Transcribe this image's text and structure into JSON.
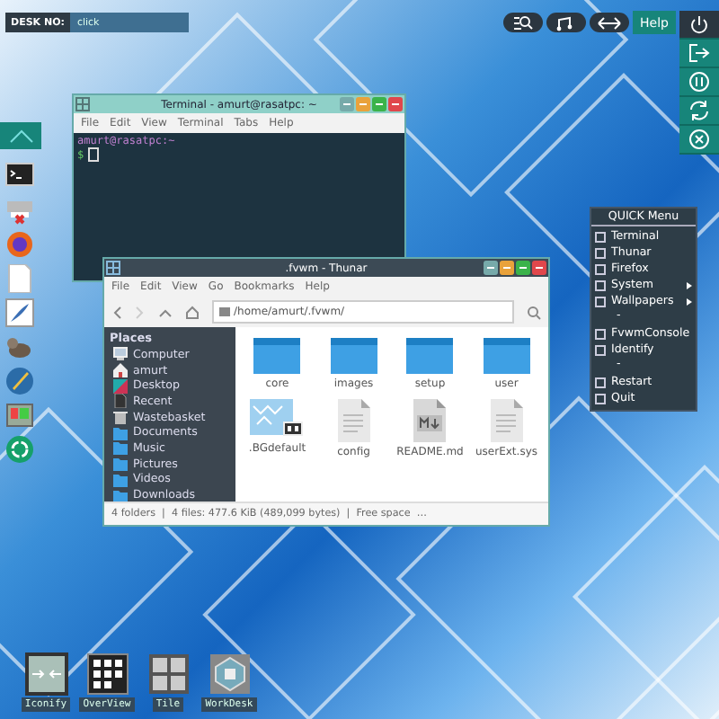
{
  "desk_switcher": {
    "label": "DESK NO:",
    "value": "click"
  },
  "top_panel": {
    "help_label": "Help"
  },
  "terminal": {
    "title": "Terminal - amurt@rasatpc: ~",
    "menu": [
      "File",
      "Edit",
      "View",
      "Terminal",
      "Tabs",
      "Help"
    ],
    "prompt": "amurt@rasatpc:~",
    "command_prompt": "$"
  },
  "file_manager": {
    "title": ".fvwm - Thunar",
    "menu": [
      "File",
      "Edit",
      "View",
      "Go",
      "Bookmarks",
      "Help"
    ],
    "path": "/home/amurt/.fvwm/",
    "places_header": "Places",
    "places": [
      {
        "label": "Computer",
        "kind": "computer",
        "selected": false
      },
      {
        "label": "amurt",
        "kind": "home",
        "selected": false
      },
      {
        "label": "Desktop",
        "kind": "desktop",
        "selected": false
      },
      {
        "label": "Recent",
        "kind": "recent",
        "selected": false
      },
      {
        "label": "Wastebasket",
        "kind": "trash",
        "selected": false
      },
      {
        "label": "Documents",
        "kind": "folder",
        "selected": false
      },
      {
        "label": "Music",
        "kind": "folder",
        "selected": false
      },
      {
        "label": "Pictures",
        "kind": "folder",
        "selected": false
      },
      {
        "label": "Videos",
        "kind": "folder",
        "selected": false
      },
      {
        "label": "Downloads",
        "kind": "folder",
        "selected": false
      }
    ],
    "files": [
      {
        "name": "core",
        "kind": "folder"
      },
      {
        "name": "images",
        "kind": "folder"
      },
      {
        "name": "setup",
        "kind": "folder"
      },
      {
        "name": "user",
        "kind": "folder"
      },
      {
        "name": ".BGdefault",
        "kind": "image"
      },
      {
        "name": "config",
        "kind": "text"
      },
      {
        "name": "README.md",
        "kind": "markdown"
      },
      {
        "name": "userExt.sys",
        "kind": "text"
      }
    ],
    "status": "4 folders  |  4 files: 477.6 KiB (489,099 bytes)  |  Free space  …"
  },
  "quick_menu": {
    "title": "QUICK Menu",
    "items": [
      {
        "kind": "entry",
        "label": "Terminal",
        "has_submenu": false
      },
      {
        "kind": "entry",
        "label": "Thunar",
        "has_submenu": false
      },
      {
        "kind": "entry",
        "label": "Firefox",
        "has_submenu": false
      },
      {
        "kind": "entry",
        "label": "System",
        "has_submenu": true
      },
      {
        "kind": "entry",
        "label": "Wallpapers",
        "has_submenu": true
      },
      {
        "kind": "separator",
        "label": "-"
      },
      {
        "kind": "entry",
        "label": "FvwmConsole",
        "has_submenu": false
      },
      {
        "kind": "entry",
        "label": "Identify",
        "has_submenu": false
      },
      {
        "kind": "separator",
        "label": "-"
      },
      {
        "kind": "entry",
        "label": "Restart",
        "has_submenu": false
      },
      {
        "kind": "entry",
        "label": "Quit",
        "has_submenu": false
      }
    ]
  },
  "bottom_buttons": [
    {
      "kind": "iconify",
      "label": "Iconify"
    },
    {
      "kind": "overview",
      "label": "OverView"
    },
    {
      "kind": "tile",
      "label": "Tile"
    },
    {
      "kind": "workdesk",
      "label": "WorkDesk"
    }
  ]
}
